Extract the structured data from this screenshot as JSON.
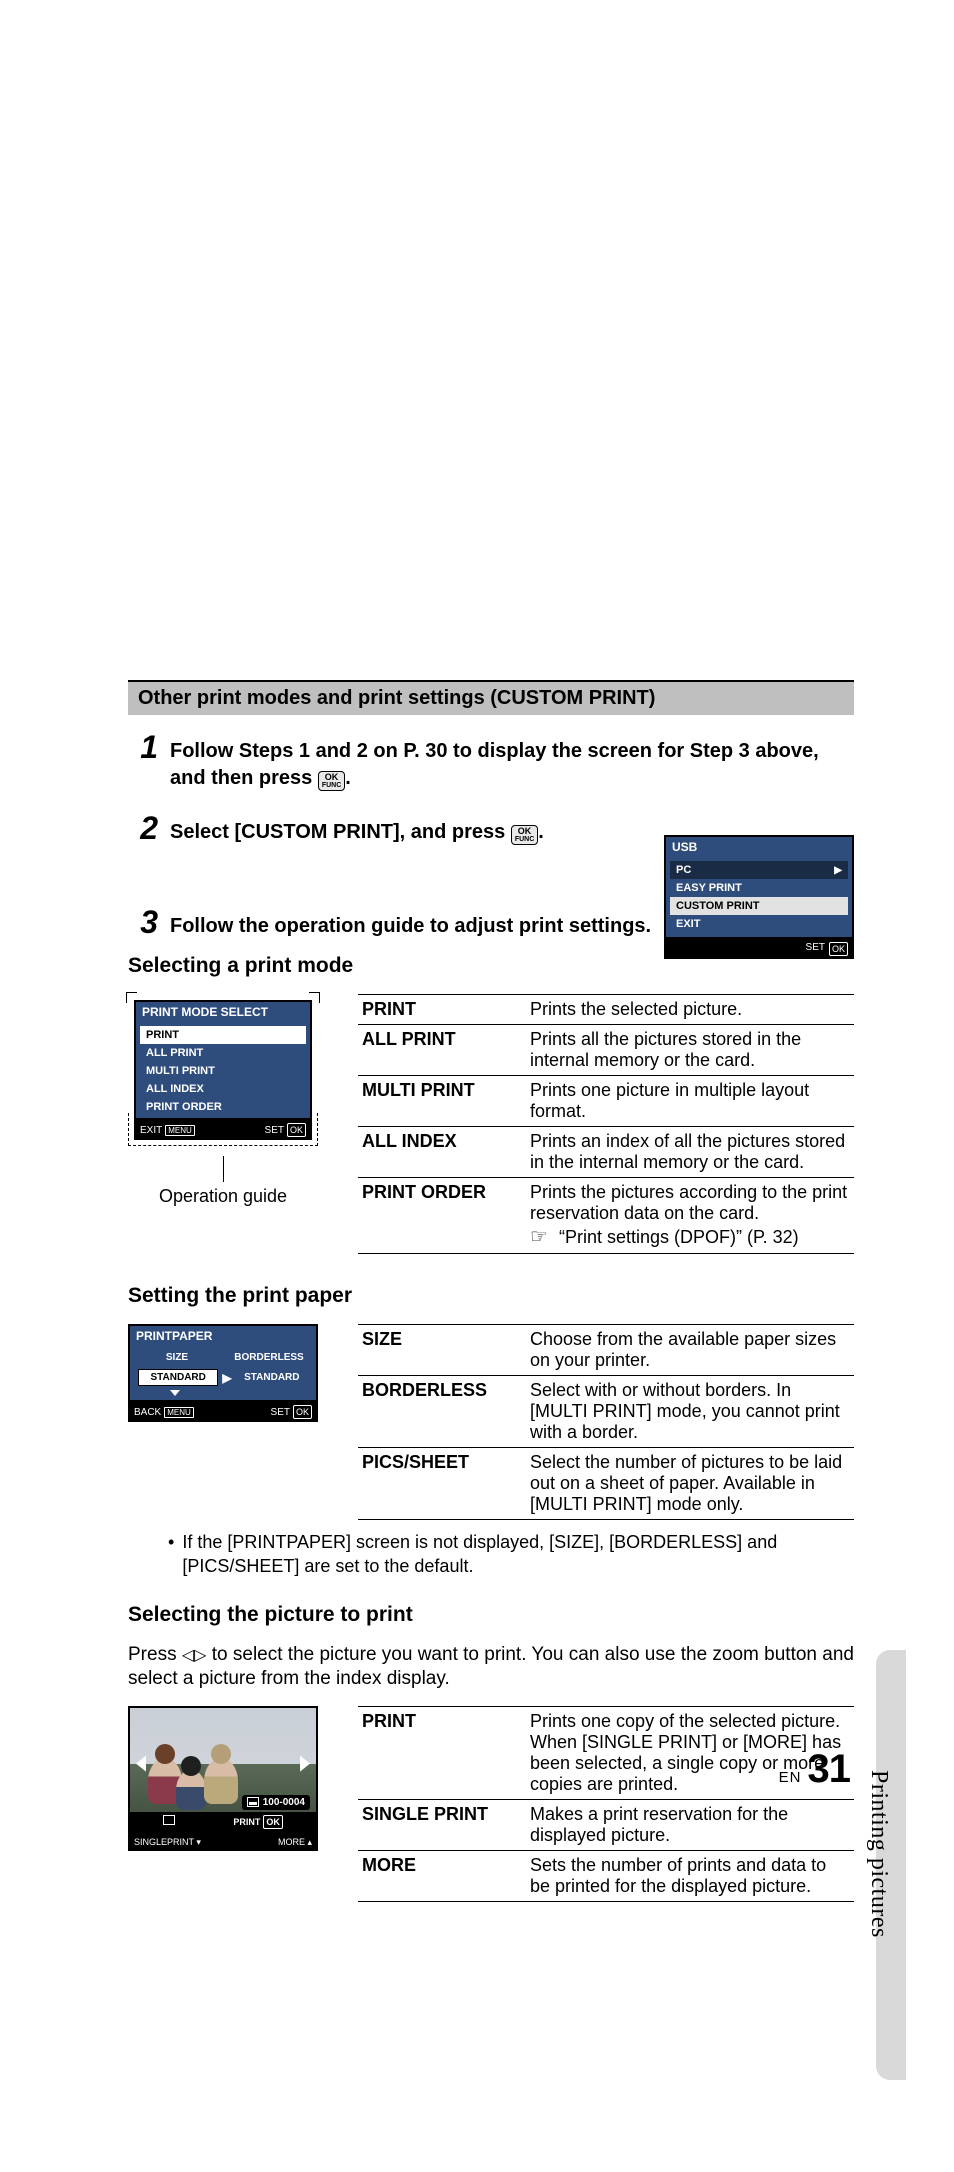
{
  "section_bar": "Other print modes and print settings (CUSTOM PRINT)",
  "steps": {
    "s1": {
      "num": "1",
      "text_a": "Follow Steps 1 and 2 on P. 30 to display the screen for Step 3 above, and then press ",
      "text_b": "."
    },
    "s2": {
      "num": "2",
      "text_a": "Select [CUSTOM PRINT], and press ",
      "text_b": "."
    },
    "s3": {
      "num": "3",
      "text": "Follow the operation guide to adjust print settings."
    }
  },
  "ok": {
    "top": "OK",
    "bot": "FUNC"
  },
  "usb_box": {
    "title": "USB",
    "items": [
      "PC",
      "EASY PRINT",
      "CUSTOM PRINT",
      "EXIT"
    ],
    "footer_set": "SET",
    "footer_ok": "OK"
  },
  "subhead1": "Selecting a print mode",
  "mode_lcd": {
    "title": "PRINT MODE SELECT",
    "items": [
      "PRINT",
      "ALL PRINT",
      "MULTI PRINT",
      "ALL INDEX",
      "PRINT ORDER"
    ],
    "exit": "EXIT",
    "menu": "MENU",
    "set": "SET",
    "ok": "OK"
  },
  "op_guide_label": "Operation guide",
  "mode_table": [
    {
      "k": "PRINT",
      "v": "Prints the selected picture."
    },
    {
      "k": "ALL PRINT",
      "v": "Prints all the pictures stored in the internal memory or the card."
    },
    {
      "k": "MULTI PRINT",
      "v": "Prints one picture in multiple layout format."
    },
    {
      "k": "ALL INDEX",
      "v": "Prints an index of all the pictures stored in the internal memory or the card."
    },
    {
      "k": "PRINT ORDER",
      "v": "Prints the pictures according to the print reservation data on the card.",
      "ref": "“Print settings (DPOF)” (P. 32)"
    }
  ],
  "subhead2": "Setting the print paper",
  "paper_lcd": {
    "title": "PRINTPAPER",
    "col1": "SIZE",
    "col2": "BORDERLESS",
    "v1": "STANDARD",
    "v2": "STANDARD",
    "back": "BACK",
    "menu": "MENU",
    "set": "SET",
    "ok": "OK"
  },
  "paper_table": [
    {
      "k": "SIZE",
      "v": "Choose from the available paper sizes on your printer."
    },
    {
      "k": "BORDERLESS",
      "v": "Select with or without borders. In [MULTI PRINT] mode, you cannot print with a border."
    },
    {
      "k": "PICS/SHEET",
      "v": "Select the number of pictures to be laid out on a sheet of paper. Available in [MULTI PRINT] mode only."
    }
  ],
  "paper_note": "If the [PRINTPAPER] screen is not displayed, [SIZE], [BORDERLESS] and [PICS/SHEET] are set to the default.",
  "subhead3": "Selecting the picture to print",
  "picture_para_a": "Press ",
  "picture_para_b": " to select the picture you want to print. You can also use the zoom button and select a picture from the index display.",
  "photo": {
    "file": "100-0004",
    "singleprint": "SINGLEPRINT",
    "print": "PRINT",
    "more": "MORE",
    "ok": "OK"
  },
  "picture_table": [
    {
      "k": "PRINT",
      "v": "Prints one copy of the selected picture. When [SINGLE PRINT] or [MORE] has been selected, a single copy or more copies are printed."
    },
    {
      "k": "SINGLE PRINT",
      "v": "Makes a print reservation for the displayed picture."
    },
    {
      "k": "MORE",
      "v": "Sets the number of prints and data to be printed for the displayed picture."
    }
  ],
  "side_text": "Printing pictures",
  "page_en": "EN",
  "page_num": "31"
}
